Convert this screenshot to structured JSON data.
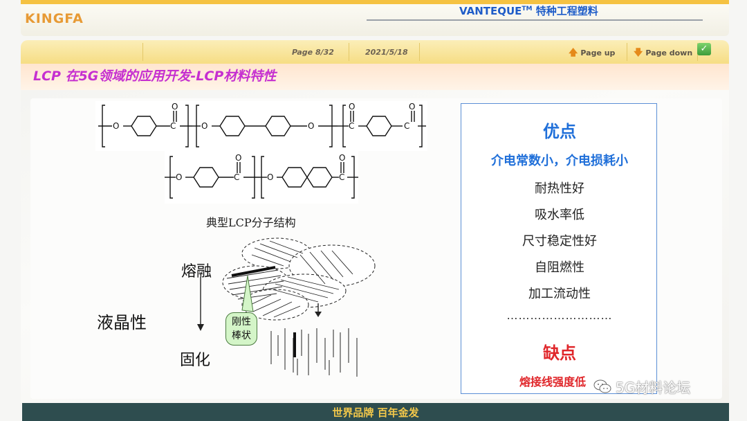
{
  "header": {
    "logo": "KINGFA",
    "brand_prefix": "VANTEQUE",
    "brand_tm": "TM",
    "brand_suffix": " 特种工程塑料"
  },
  "nav": {
    "page": "Page  8/32",
    "date": "2021/5/18",
    "page_up": "Page up",
    "page_down": "Page down",
    "accent_color": "#e58a1a"
  },
  "slide": {
    "title": "LCP 在5G领域的应用开发-LCP材料特性",
    "title_color": "#c52fd0"
  },
  "molecule": {
    "caption": "典型LCP分子结构"
  },
  "liquid_crystal": {
    "melt_label": "熔融",
    "category_label": "液晶性",
    "solid_label": "固化",
    "rod_label_line1": "刚性",
    "rod_label_line2": "棒状"
  },
  "panel": {
    "pros_title": "优点",
    "pros_main": "介电常数小，介电损耗小",
    "pros_items": [
      "耐热性好",
      "吸水率低",
      "尺寸稳定性好",
      "自阻燃性",
      "加工流动性"
    ],
    "separator": "………………………",
    "cons_title": "缺点",
    "cons_item": "熔接线强度低",
    "pro_color": "#1f6fd9",
    "con_color": "#e0262a"
  },
  "watermark": {
    "text": "5G材料论坛"
  },
  "footer": {
    "slogan": "世界品牌 百年金发",
    "bg_color": "#2e4d4f"
  }
}
